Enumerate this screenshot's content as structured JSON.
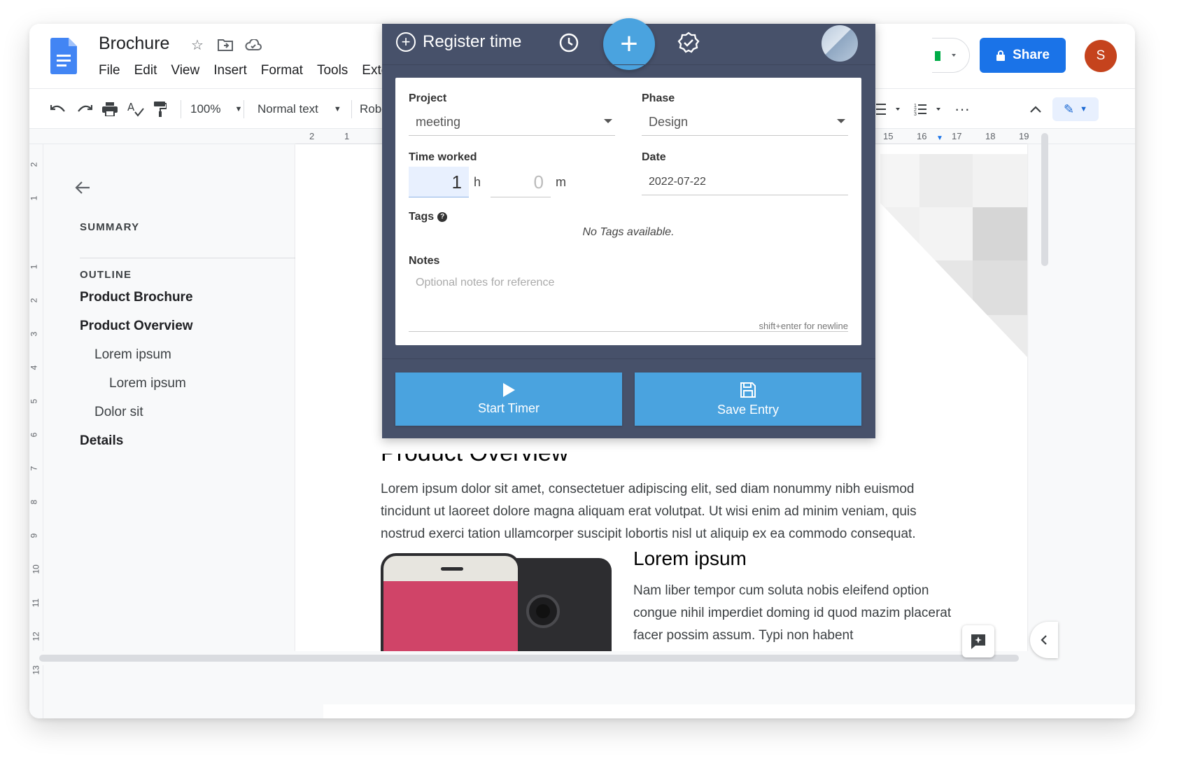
{
  "doc": {
    "title": "Brochure",
    "menu": [
      "File",
      "Edit",
      "View",
      "Insert",
      "Format",
      "Tools",
      "Extens"
    ],
    "share_label": "Share",
    "user_initial": "S"
  },
  "toolbar": {
    "zoom": "100%",
    "style": "Normal text",
    "font": "Robo"
  },
  "ruler": {
    "horizontal_left": [
      "2",
      "1"
    ],
    "horizontal_right": [
      "15",
      "16",
      "17",
      "18",
      "19"
    ],
    "vertical": [
      "2",
      "1",
      "1",
      "2",
      "3",
      "4",
      "5",
      "6",
      "7",
      "8",
      "9",
      "10",
      "11",
      "12",
      "13"
    ]
  },
  "sidebar": {
    "summary_label": "SUMMARY",
    "outline_label": "OUTLINE",
    "outline": [
      {
        "label": "Product Brochure",
        "level": 1
      },
      {
        "label": "Product Overview",
        "level": 1
      },
      {
        "label": "Lorem ipsum",
        "level": 2
      },
      {
        "label": "Lorem ipsum",
        "level": 3
      },
      {
        "label": "Dolor sit",
        "level": 2
      },
      {
        "label": "Details",
        "level": 1
      }
    ]
  },
  "content": {
    "heading": "Product Overview",
    "paragraph": "Lorem ipsum dolor sit amet, consectetuer adipiscing elit, sed diam nonummy nibh euismod tincidunt ut laoreet dolore magna aliquam erat volutpat. Ut wisi enim ad minim veniam, quis nostrud exerci tation ullamcorper suscipit lobortis nisl ut aliquip ex ea commodo consequat.",
    "subheading": "Lorem ipsum",
    "subparagraph": "Nam liber tempor cum soluta nobis eleifend option congue nihil imperdiet doming id quod mazim placerat facer possim assum. Typi non habent"
  },
  "tracker": {
    "header_label": "Register time",
    "project_label": "Project",
    "project_value": "meeting",
    "phase_label": "Phase",
    "phase_value": "Design",
    "time_label": "Time worked",
    "hours_value": "1",
    "hours_unit": "h",
    "minutes_value": "0",
    "minutes_unit": "m",
    "date_label": "Date",
    "date_value": "2022-07-22",
    "tags_label": "Tags",
    "tags_empty": "No Tags available.",
    "notes_label": "Notes",
    "notes_placeholder": "Optional notes for reference",
    "notes_hint": "shift+enter for newline",
    "start_label": "Start Timer",
    "save_label": "Save Entry"
  },
  "colors": {
    "tracker_bg": "#47516a",
    "accent": "#4aa3df",
    "share": "#1a73e8",
    "avatar": "#c5431d"
  }
}
